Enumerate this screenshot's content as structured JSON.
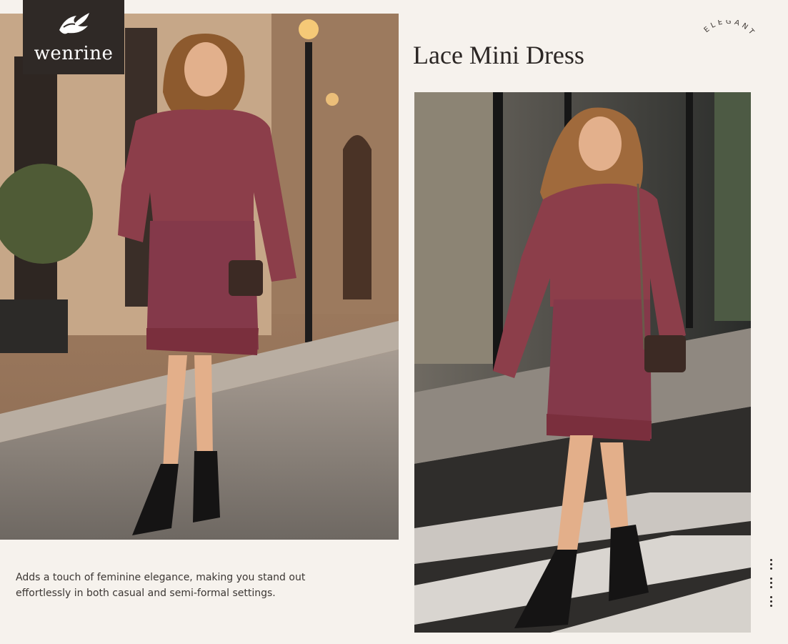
{
  "brand": {
    "name": "wenrine",
    "logo_icon": "bird-icon"
  },
  "product": {
    "title": "Lace Mini Dress",
    "tag": "ELEGANT"
  },
  "description": {
    "line1": "Adds a touch of feminine elegance, making you stand out",
    "line2": "effortlessly in both casual and semi-formal settings."
  },
  "colors": {
    "background": "#f6f2ed",
    "logo_bg": "#2f2926",
    "dress": "#8c3e4a",
    "text": "#2b2624"
  },
  "photos": [
    {
      "name": "photo-left",
      "subject": "woman-in-ribbed-lace-mini-dress-street"
    },
    {
      "name": "photo-right",
      "subject": "woman-walking-crosswalk-lace-mini-dress"
    }
  ]
}
